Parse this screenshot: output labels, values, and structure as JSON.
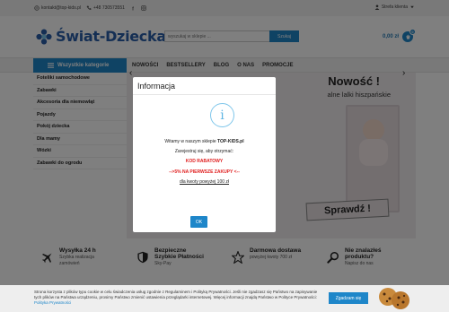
{
  "topbar": {
    "email": "kontakt@top-kids.pl",
    "phone": "+48 730573551",
    "account": "Strefa klienta"
  },
  "header": {
    "logo": "Świat-Dziecka",
    "search_placeholder": "wyszukaj w sklepie ...",
    "search_button": "Szukaj",
    "cart_total": "0,00 zł",
    "cart_count": "0"
  },
  "nav": {
    "categories_button": "Wszystkie kategorie",
    "links": [
      "NOWOŚCI",
      "BESTSELLERY",
      "BLOG",
      "O NAS",
      "PROMOCJE"
    ]
  },
  "sidebar": {
    "items": [
      "Foteliki samochodowe",
      "Zabawki",
      "Akcesoria dla niemowląt",
      "Pojazdy",
      "Pokój dziecka",
      "Dla mamy",
      "Wózki",
      "Zabawki do ogrodu"
    ]
  },
  "banner": {
    "title": "Nowość !",
    "subtitle": "alne lalki hiszpańskie",
    "cta": "Sprawdź !"
  },
  "modal": {
    "title": "Informacja",
    "line1_prefix": "Witamy w naszym sklepie ",
    "line1_store": "TOP-KIDS.pl",
    "line2": "Zarejestruj się, aby otrzymać:",
    "line3": "KOD RABATOWY",
    "line4": "-->5% NA PIERWSZE ZAKUPY <--",
    "line5": "dla kwoty powyżej 100 zł",
    "ok": "OK"
  },
  "features": [
    {
      "title": "Wysyłka 24 h",
      "sub1": "Szybka realizacja",
      "sub2": "zamówień",
      "icon": "airplane-icon"
    },
    {
      "title": "Bezpieczne",
      "sub1": "Szybkie Płatności",
      "sub2": "Sky-Pay",
      "icon": "shield-icon"
    },
    {
      "title": "Darmowa dostawa",
      "sub1": "powyżej kwoty 700 zł",
      "sub2": "",
      "icon": "star-icon"
    },
    {
      "title": "Nie znalazłeś",
      "sub1": "produktu?",
      "sub2": "Napisz do nas",
      "icon": "search-icon"
    }
  ],
  "cookie": {
    "text": "Strona korzysta z plików typu cookie w celu świadczenia usług zgodnie z Regulaminem i Polityką Prywatności. Jeśli nie zgadzasz się Państwo na zapisywanie tych plików na Państwa urządzeniu, prosimy Państwo zmienić ustawienia przeglądarki internetowej. Więcej informacji znajdą Państwo w Polityce Prywatności:",
    "link": "Polityka Prywatności",
    "button": "Zgadzam się"
  },
  "colors": {
    "accent": "#1e86c9",
    "promo_red": "#e02020"
  }
}
